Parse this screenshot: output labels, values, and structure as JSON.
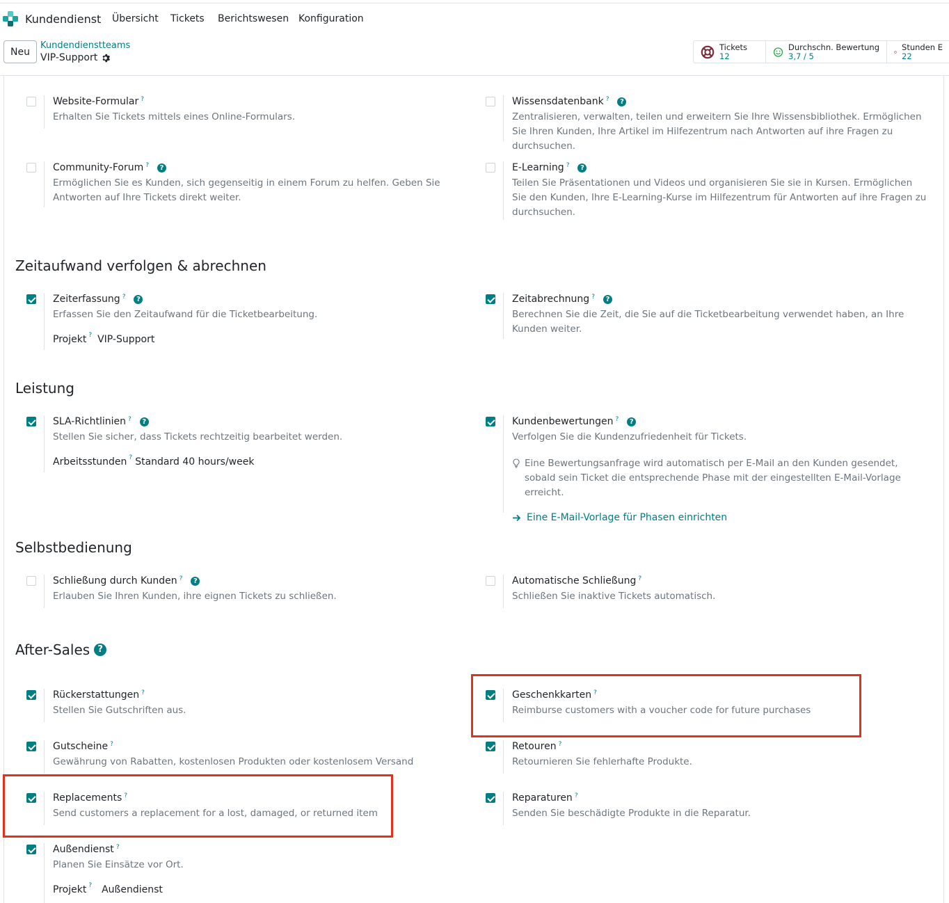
{
  "app": {
    "name": "Kundendienst",
    "menu": [
      "Übersicht",
      "Tickets",
      "Berichtswesen",
      "Konfiguration"
    ]
  },
  "control": {
    "new_label": "Neu",
    "breadcrumb_parent": "Kundendienstteams",
    "breadcrumb_current": "VIP-Support"
  },
  "stats": [
    {
      "label": "Tickets",
      "value": "12"
    },
    {
      "label": "Durchschn. Bewertung",
      "value": "3,7 / 5"
    },
    {
      "label": "Stunden E",
      "value": "22"
    }
  ],
  "help_mark": "?",
  "sections": {
    "zeit": "Zeitaufwand verfolgen & abrechnen",
    "leistung": "Leistung",
    "selbst": "Selbstbedienung",
    "after": "After-Sales"
  },
  "settings": {
    "website": {
      "title": "Website-Formular",
      "desc": "Erhalten Sie Tickets mittels eines Online-Formulars.",
      "checked": false
    },
    "wissen": {
      "title": "Wissensdatenbank",
      "desc": "Zentralisieren, verwalten, teilen und erweitern Sie Ihre Wissensbibliothek. Ermöglichen Sie Ihren Kunden, Ihre Artikel im Hilfezentrum nach Antworten auf ihre Fragen zu durchsuchen.",
      "checked": false
    },
    "forum": {
      "title": "Community-Forum",
      "desc": "Ermöglichen Sie es Kunden, sich gegenseitig in einem Forum zu helfen. Geben Sie Antworten auf Ihre Tickets direkt weiter.",
      "checked": false
    },
    "elearning": {
      "title": "E-Learning",
      "desc": "Teilen Sie Präsentationen und Videos und organisieren Sie sie in Kursen. Ermöglichen Sie den Kunden, Ihre E-Learning-Kurse im Hilfezentrum für Antworten auf ihre Fragen zu durchsuchen.",
      "checked": false
    },
    "zeiterfassung": {
      "title": "Zeiterfassung",
      "desc": "Erfassen Sie den Zeitaufwand für die Ticketbearbeitung.",
      "checked": true,
      "sub_label": "Projekt",
      "sub_value": "VIP-Support"
    },
    "zeitabrechnung": {
      "title": "Zeitabrechnung",
      "desc": "Berechnen Sie die Zeit, die Sie auf die Ticketbearbeitung verwendet haben, an Ihre Kunden weiter.",
      "checked": true
    },
    "sla": {
      "title": "SLA-Richtlinien",
      "desc": "Stellen Sie sicher, dass Tickets rechtzeitig bearbeitet werden.",
      "checked": true,
      "sub_label": "Arbeitsstunden",
      "sub_value": "Standard 40 hours/week"
    },
    "bewertung": {
      "title": "Kundenbewertungen",
      "desc": "Verfolgen Sie die Kundenzufriedenheit für Tickets.",
      "checked": true,
      "hint": "Eine Bewertungsanfrage wird automatisch per E-Mail an den Kunden gesendet, sobald sein Ticket die entsprechende Phase mit der eingestellten E-Mail-Vorlage erreicht.",
      "link": "Eine E-Mail-Vorlage für Phasen einrichten"
    },
    "schliessung_kunde": {
      "title": "Schließung durch Kunden",
      "desc": "Erlauben Sie Ihren Kunden, ihre eignen Tickets zu schließen.",
      "checked": false
    },
    "auto_schliessung": {
      "title": "Automatische Schließung",
      "desc": "Schließen Sie inaktive Tickets automatisch.",
      "checked": false
    },
    "rueckerstattung": {
      "title": "Rückerstattungen",
      "desc": "Stellen Sie Gutschriften aus.",
      "checked": true
    },
    "geschenkkarten": {
      "title": "Geschenkkarten",
      "desc": "Reimburse customers with a voucher code for future purchases",
      "checked": true
    },
    "gutscheine": {
      "title": "Gutscheine",
      "desc": "Gewährung von Rabatten, kostenlosen Produkten oder kostenlosem Versand",
      "checked": true
    },
    "retouren": {
      "title": "Retouren",
      "desc": "Retournieren Sie fehlerhafte Produkte.",
      "checked": true
    },
    "replacements": {
      "title": "Replacements",
      "desc": "Send customers a replacement for a lost, damaged, or returned item",
      "checked": true
    },
    "reparaturen": {
      "title": "Reparaturen",
      "desc": "Senden Sie beschädigte Produkte in die Reparatur.",
      "checked": true
    },
    "aussendienst": {
      "title": "Außendienst",
      "desc": "Planen Sie Einsätze vor Ort.",
      "checked": true,
      "sub_label": "Projekt",
      "sub_value": "Außendienst"
    }
  },
  "colors": {
    "accent": "#017e84",
    "highlight": "#e0321c"
  }
}
